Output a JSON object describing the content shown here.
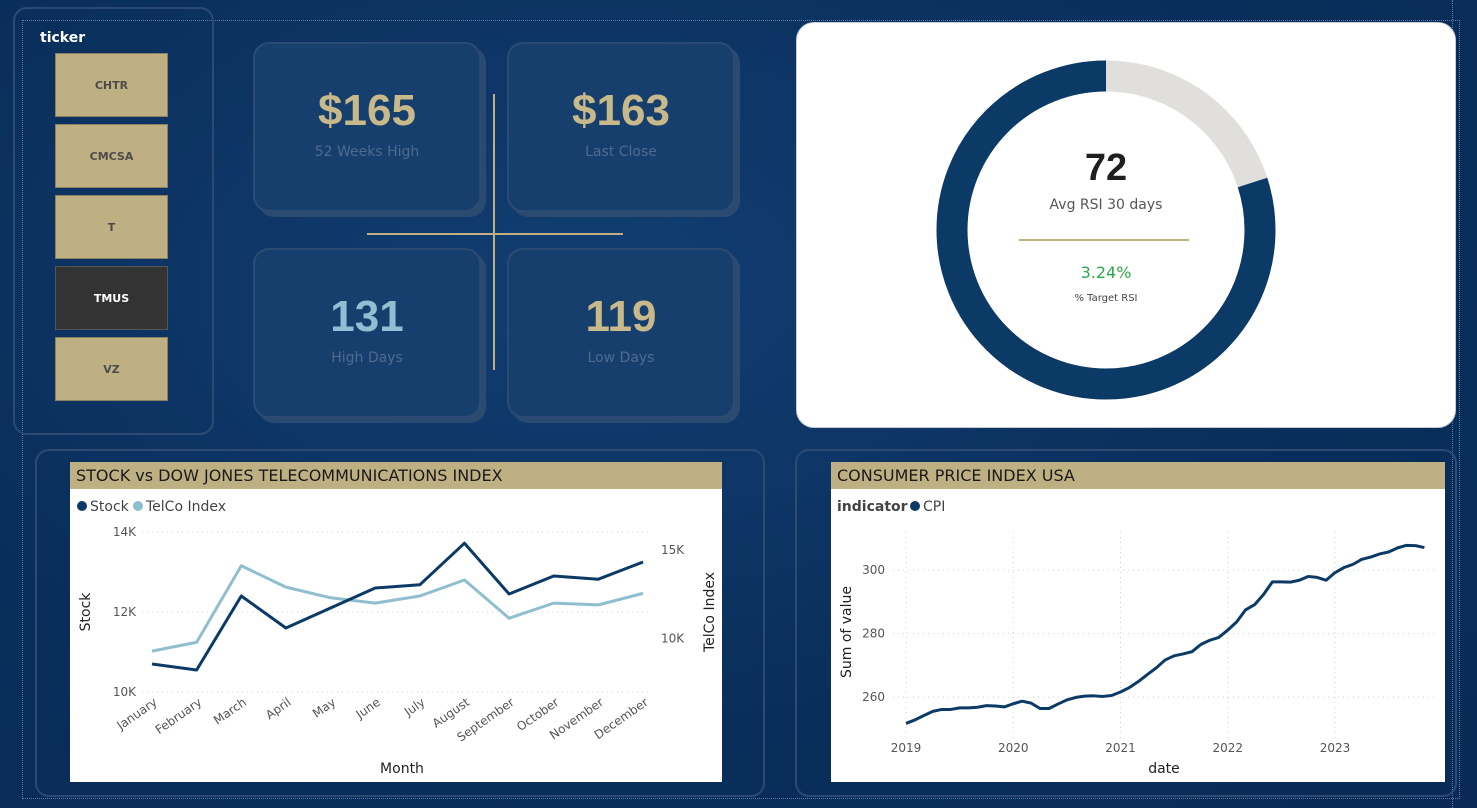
{
  "ticker": {
    "title": "ticker",
    "items": [
      "CHTR",
      "CMCSA",
      "T",
      "TMUS",
      "VZ"
    ],
    "selected": "TMUS"
  },
  "kpis": {
    "high52": {
      "value": "$165",
      "label": "52 Weeks High"
    },
    "last_close": {
      "value": "$163",
      "label": "Last Close"
    },
    "high_days": {
      "value": "131",
      "label": "High Days"
    },
    "low_days": {
      "value": "119",
      "label": "Low Days"
    }
  },
  "rsi": {
    "value": "72",
    "label": "Avg RSI 30 days",
    "pct": "3.24%",
    "pct_label": "% Target RSI",
    "fraction": 0.8
  },
  "colors": {
    "navy": "#0b3a66",
    "gold": "#bfb083",
    "light_blue": "#8fbfcf",
    "green": "#2ea84a",
    "donut_rest": "#e0dfdb"
  },
  "stock_chart": {
    "title": "STOCK vs DOW JONES TELECOMMUNICATIONS INDEX",
    "legend": [
      "Stock",
      "TelCo Index"
    ],
    "xlabel": "Month",
    "ylabel_left": "Stock",
    "ylabel_right": "TelCo Index",
    "left_ticks": [
      "14K",
      "12K",
      "10K"
    ],
    "right_ticks": [
      "15K",
      "10K"
    ]
  },
  "cpi_chart": {
    "title": "CONSUMER PRICE INDEX USA",
    "legend_title": "indicator",
    "legend": [
      "CPI"
    ],
    "xlabel": "date",
    "ylabel": "Sum of value",
    "y_ticks": [
      "300",
      "280",
      "260"
    ],
    "x_ticks": [
      "2019",
      "2020",
      "2021",
      "2022",
      "2023"
    ]
  },
  "chart_data": [
    {
      "type": "line",
      "title": "STOCK vs DOW JONES TELECOMMUNICATIONS INDEX",
      "xlabel": "Month",
      "categories": [
        "January",
        "February",
        "March",
        "April",
        "May",
        "June",
        "July",
        "August",
        "September",
        "October",
        "November",
        "December"
      ],
      "series": [
        {
          "name": "Stock",
          "axis": "left",
          "values": [
            10700,
            10550,
            12400,
            11600,
            12100,
            12600,
            12680,
            13720,
            12450,
            12900,
            12820,
            13250
          ]
        },
        {
          "name": "TelCo Index",
          "axis": "right",
          "values": [
            9300,
            9800,
            14100,
            12900,
            12300,
            12000,
            12400,
            13300,
            11150,
            12000,
            11900,
            12550
          ]
        }
      ],
      "ylim_left": [
        10000,
        14000
      ],
      "ylim_right": [
        7000,
        16000
      ],
      "ylabel": "Stock",
      "ylabel_right": "TelCo Index"
    },
    {
      "type": "line",
      "title": "CONSUMER PRICE INDEX USA",
      "xlabel": "date",
      "ylabel": "Sum of value",
      "x": [
        "2019-01",
        "2019-02",
        "2019-03",
        "2019-04",
        "2019-05",
        "2019-06",
        "2019-07",
        "2019-08",
        "2019-09",
        "2019-10",
        "2019-11",
        "2019-12",
        "2020-01",
        "2020-02",
        "2020-03",
        "2020-04",
        "2020-05",
        "2020-06",
        "2020-07",
        "2020-08",
        "2020-09",
        "2020-10",
        "2020-11",
        "2020-12",
        "2021-01",
        "2021-02",
        "2021-03",
        "2021-04",
        "2021-05",
        "2021-06",
        "2021-07",
        "2021-08",
        "2021-09",
        "2021-10",
        "2021-11",
        "2021-12",
        "2022-01",
        "2022-02",
        "2022-03",
        "2022-04",
        "2022-05",
        "2022-06",
        "2022-07",
        "2022-08",
        "2022-09",
        "2022-10",
        "2022-11",
        "2022-12",
        "2023-01",
        "2023-02",
        "2023-03",
        "2023-04",
        "2023-05",
        "2023-06",
        "2023-07",
        "2023-08",
        "2023-09",
        "2023-10",
        "2023-11"
      ],
      "series": [
        {
          "name": "CPI",
          "values": [
            251.7,
            252.8,
            254.2,
            255.5,
            256.1,
            256.1,
            256.6,
            256.6,
            256.8,
            257.3,
            257.2,
            256.9,
            257.9,
            258.7,
            258.1,
            256.4,
            256.4,
            257.8,
            259.1,
            259.9,
            260.3,
            260.4,
            260.2,
            260.5,
            261.6,
            263.0,
            264.9,
            267.1,
            269.2,
            271.7,
            273.0,
            273.6,
            274.3,
            276.6,
            277.9,
            278.8,
            281.1,
            283.7,
            287.5,
            289.1,
            292.3,
            296.3,
            296.3,
            296.2,
            296.8,
            298.0,
            297.7,
            296.8,
            299.2,
            300.8,
            301.8,
            303.4,
            304.1,
            305.1,
            305.7,
            307.0,
            307.8,
            307.7,
            307.1
          ]
        }
      ],
      "ylim": [
        249,
        312
      ]
    }
  ]
}
